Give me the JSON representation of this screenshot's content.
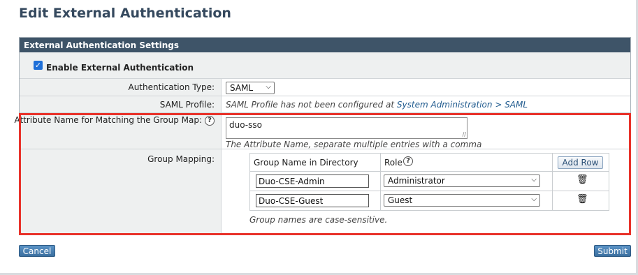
{
  "page_title": "Edit External Authentication",
  "panel_header": "External Authentication Settings",
  "enable_label": "Enable External Authentication",
  "enable_checked": true,
  "auth_type": {
    "label": "Authentication Type:",
    "value": "SAML"
  },
  "saml_profile": {
    "label": "SAML Profile:",
    "note": "SAML Profile has not been configured at ",
    "link": "System Administration > SAML"
  },
  "attribute_name": {
    "label": "Attribute Name for Matching the Group Map:",
    "help": "?",
    "value": "duo-sso",
    "hint": "The Attribute Name, separate multiple entries with a comma"
  },
  "group_mapping": {
    "label": "Group Mapping:",
    "col_group": "Group Name in Directory",
    "col_role": "Role",
    "help": "?",
    "add_row": "Add Row",
    "rows": [
      {
        "group": "Duo-CSE-Admin",
        "role": "Administrator"
      },
      {
        "group": "Duo-CSE-Guest",
        "role": "Guest"
      }
    ],
    "note": "Group names are case-sensitive."
  },
  "cancel_label": "Cancel",
  "submit_label": "Submit",
  "colors": {
    "header_bg": "#3e5468",
    "highlight": "#e8322a",
    "button_blue": "#4a80b3"
  },
  "icons": [
    "checkbox-icon",
    "help-icon",
    "chevron-down-icon",
    "trash-icon",
    "resize-icon"
  ]
}
